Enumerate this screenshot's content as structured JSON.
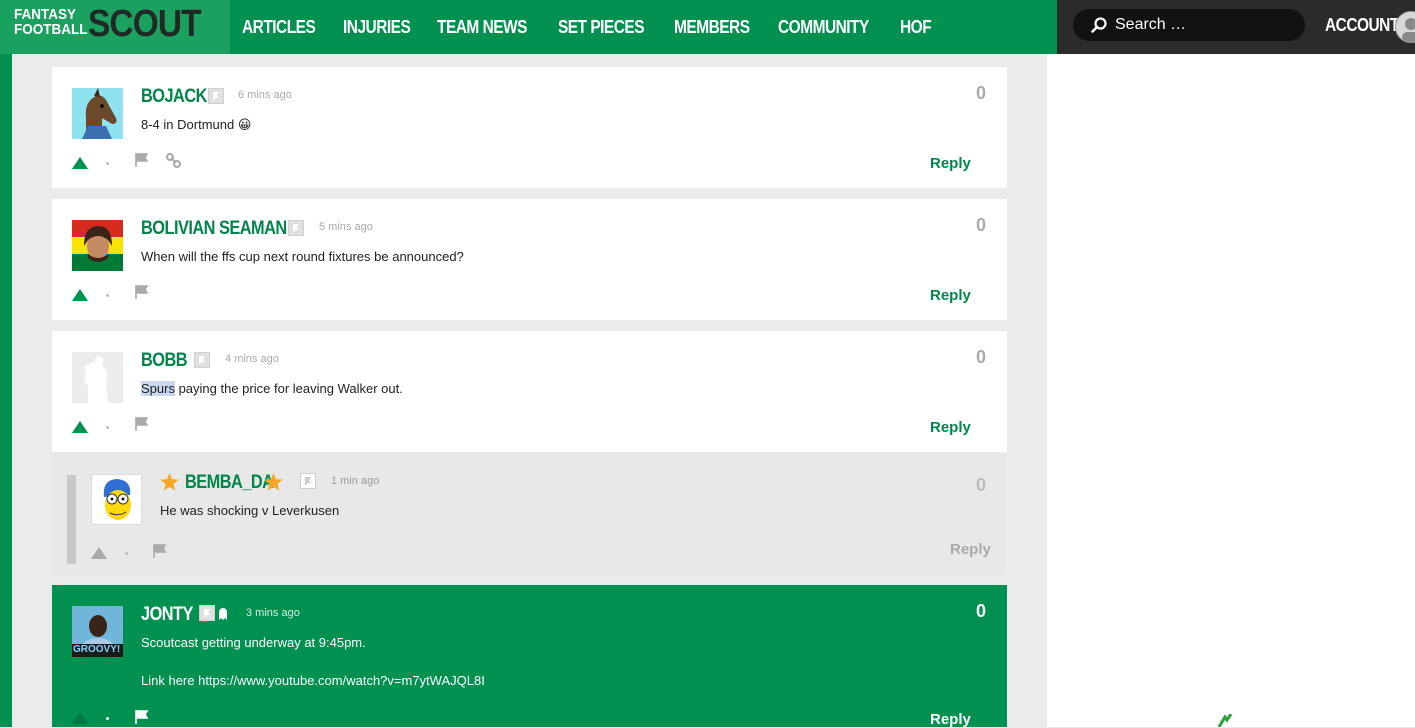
{
  "header": {
    "logo_line1": "FANTASY",
    "logo_line2": "FOOTBALL",
    "logo_big": "SCOUT",
    "nav": [
      "ARTICLES",
      "INJURIES",
      "TEAM NEWS",
      "SET PIECES",
      "MEMBERS",
      "COMMUNITY",
      "HOF"
    ],
    "search_placeholder": "Search …",
    "account_label": "ACCOUNT"
  },
  "comments": [
    {
      "user": "BOJACK",
      "time": "6 mins ago",
      "text": "8-4 in Dortmund 😀",
      "score": "0",
      "reply": "Reply"
    },
    {
      "user": "BOLIVIAN SEAMAN",
      "time": "5 mins ago",
      "text": "When will the ffs cup next round fixtures be announced?",
      "score": "0",
      "reply": "Reply"
    },
    {
      "user": "BOBB",
      "time": "4 mins ago",
      "text_highlight": "Spurs",
      "text_rest": " paying the price for leaving Walker out.",
      "score": "0",
      "reply": "Reply"
    },
    {
      "user": "BEMBA_DA",
      "time": "1 min ago",
      "text": "He was shocking v Leverkusen",
      "score": "0",
      "reply": "Reply"
    },
    {
      "user": "JONTY",
      "time": "3 mins ago",
      "text": "Scoutcast getting underway at 9:45pm.",
      "text2": "Link here https://www.youtube.com/watch?v=m7ytWAJQL8I",
      "score": "0",
      "reply": "Reply",
      "avatar_caption": "GROOVY!"
    }
  ],
  "colors": {
    "brand_green": "#00904f",
    "link_green": "#00864a",
    "star": "#f5a623"
  }
}
